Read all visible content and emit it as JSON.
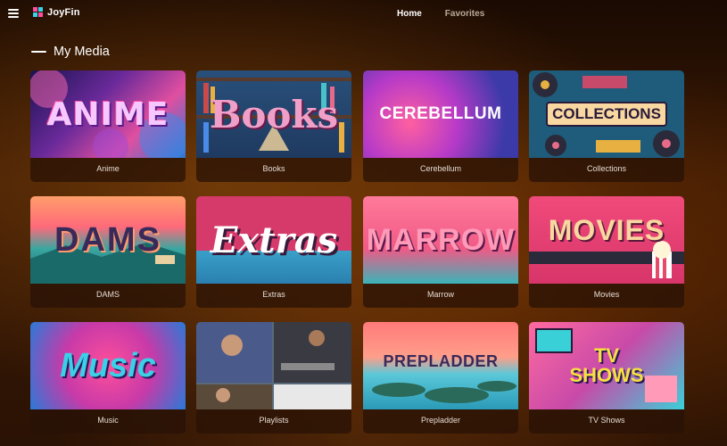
{
  "app": {
    "name": "JoyFin"
  },
  "nav": {
    "tabs": [
      {
        "label": "Home",
        "active": true
      },
      {
        "label": "Favorites",
        "active": false
      }
    ]
  },
  "section": {
    "title": "My Media"
  },
  "libraries": [
    {
      "label": "Anime",
      "art_text": "ANIME"
    },
    {
      "label": "Books",
      "art_text": "Books"
    },
    {
      "label": "Cerebellum",
      "art_text": "CEREBELLUM"
    },
    {
      "label": "Collections",
      "art_text": "COLLECTIONS"
    },
    {
      "label": "DAMS",
      "art_text": "DAMS"
    },
    {
      "label": "Extras",
      "art_text": "Extras"
    },
    {
      "label": "Marrow",
      "art_text": "MARROW"
    },
    {
      "label": "Movies",
      "art_text": "MOVIES"
    },
    {
      "label": "Music",
      "art_text": "Music"
    },
    {
      "label": "Playlists",
      "art_text": ""
    },
    {
      "label": "Prepladder",
      "art_text": "PREPLADDER"
    },
    {
      "label": "TV Shows",
      "art_text": "TV SHOWS"
    }
  ],
  "colors": {
    "accent_pink": "#ff4fa3",
    "accent_cyan": "#34d6e8",
    "inactive_tab": "#b9a999"
  }
}
